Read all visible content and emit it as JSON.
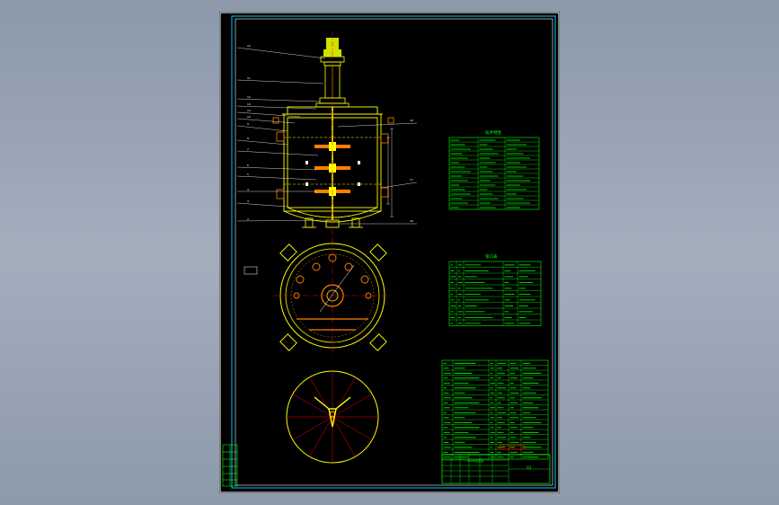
{
  "drawing": {
    "colors": {
      "background": "#8c99ab",
      "sheet": "#000000",
      "border": "#ffffff",
      "frame": "#00c8ff",
      "vessel": "#ffff00",
      "motor": "#d0e000",
      "leader": "#ffffff",
      "table": "#00ff00",
      "centerline": "#ff0000",
      "detail": "#ffff00",
      "accent": "#ff8000",
      "stamp": "#ff0000"
    },
    "part_numbers_left": [
      "15",
      "11",
      "12",
      "13",
      "14",
      "10",
      "9",
      "8",
      "7",
      "6",
      "5",
      "4",
      "3",
      "2"
    ],
    "part_numbers_right": [
      "16",
      "17",
      "18"
    ],
    "section_labels": [
      "N1",
      "N2",
      "N3",
      "N4",
      "N5",
      "N6"
    ],
    "tech_table_title": "技术特性",
    "nozzle_table_title": "管口表",
    "title_block_name": "5000L反应釜",
    "title_block_code": "01"
  }
}
